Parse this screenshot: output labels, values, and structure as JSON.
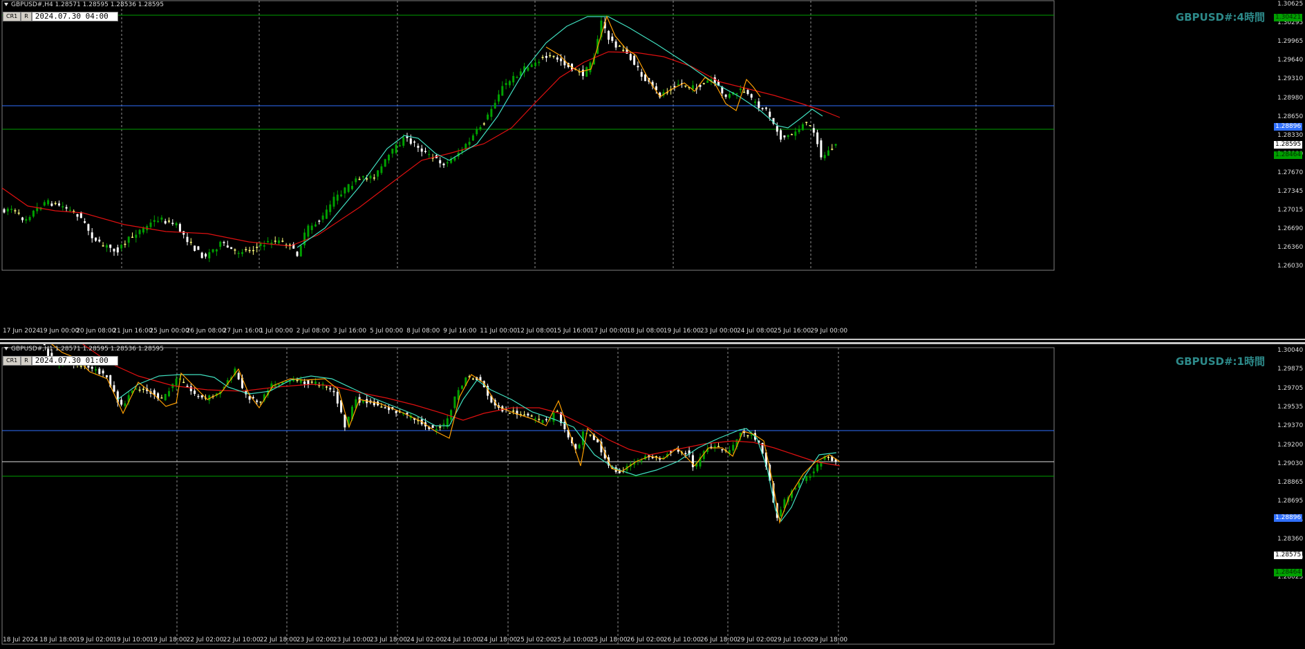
{
  "h4": {
    "header": "GBPUSD#,H4  1.28571 1.28595 1.28536 1.28595",
    "btn_cr": "CR1",
    "btn_r": "R",
    "datetime": "2024.07.30 04:00",
    "title": "GBPUSD#:4時間",
    "y_ticks": [
      "1.30625",
      "1.30295",
      "1.29965",
      "1.29640",
      "1.29310",
      "1.28980",
      "1.28650",
      "1.28330",
      "1.28000",
      "1.27670",
      "1.27345",
      "1.27015",
      "1.26690",
      "1.26360",
      "1.26030"
    ],
    "x_ticks": [
      "17 Jun 2024",
      "19 Jun 00:00",
      "20 Jun 08:00",
      "21 Jun 16:00",
      "25 Jun 00:00",
      "26 Jun 08:00",
      "27 Jun 16:00",
      "1 Jul 00:00",
      "2 Jul 08:00",
      "3 Jul 16:00",
      "5 Jul 00:00",
      "8 Jul 08:00",
      "9 Jul 16:00",
      "11 Jul 00:00",
      "12 Jul 08:00",
      "15 Jul 16:00",
      "17 Jul 00:00",
      "18 Jul 08:00",
      "19 Jul 16:00",
      "23 Jul 00:00",
      "24 Jul 08:00",
      "25 Jul 16:00",
      "29 Jul 00:00"
    ],
    "price_tags": {
      "top_green": "1.30421",
      "blue": "1.28896",
      "white": "1.28595",
      "green": "1.28464"
    }
  },
  "h1": {
    "header": "GBPUSD#,H1  1.28571 1.28595 1.28536 1.28595",
    "btn_cr": "CR1",
    "btn_r": "R",
    "datetime": "2024.07.30 01:00",
    "title": "GBPUSD#:1時間",
    "y_ticks": [
      "1.30040",
      "1.29875",
      "1.29705",
      "1.29535",
      "1.29370",
      "1.29200",
      "1.29030",
      "1.28865",
      "1.28695",
      "1.28525",
      "1.28360",
      "1.28190",
      "1.28025"
    ],
    "x_ticks": [
      "18 Jul 2024",
      "18 Jul 18:00",
      "19 Jul 02:00",
      "19 Jul 10:00",
      "19 Jul 18:00",
      "22 Jul 02:00",
      "22 Jul 10:00",
      "22 Jul 18:00",
      "23 Jul 02:00",
      "23 Jul 10:00",
      "23 Jul 18:00",
      "24 Jul 02:00",
      "24 Jul 10:00",
      "24 Jul 18:00",
      "25 Jul 02:00",
      "25 Jul 10:00",
      "25 Jul 18:00",
      "26 Jul 02:00",
      "26 Jul 10:00",
      "26 Jul 18:00",
      "29 Jul 02:00",
      "29 Jul 10:00",
      "29 Jul 18:00"
    ],
    "price_tags": {
      "blue": "1.28896",
      "white": "1.28575",
      "green": "1.28464"
    }
  },
  "colors": {
    "bull": "#00a000",
    "bear": "#ffffff",
    "doji": "#ffff80",
    "ma_red": "#e01010",
    "ma_cyan": "#40e0c0",
    "zz_orange": "#ffa000",
    "line_blue": "#3070ff",
    "line_green": "#00a000",
    "grid": "#909090"
  }
}
